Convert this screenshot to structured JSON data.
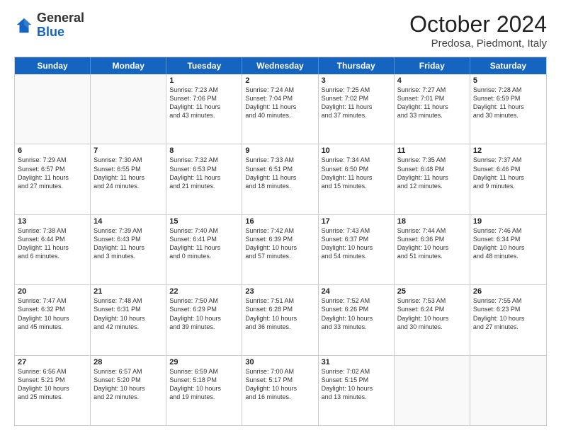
{
  "header": {
    "logo_general": "General",
    "logo_blue": "Blue",
    "month_year": "October 2024",
    "location": "Predosa, Piedmont, Italy"
  },
  "days_of_week": [
    "Sunday",
    "Monday",
    "Tuesday",
    "Wednesday",
    "Thursday",
    "Friday",
    "Saturday"
  ],
  "rows": [
    [
      {
        "day": "",
        "info": "",
        "empty": true
      },
      {
        "day": "",
        "info": "",
        "empty": true
      },
      {
        "day": "1",
        "info": "Sunrise: 7:23 AM\nSunset: 7:06 PM\nDaylight: 11 hours\nand 43 minutes."
      },
      {
        "day": "2",
        "info": "Sunrise: 7:24 AM\nSunset: 7:04 PM\nDaylight: 11 hours\nand 40 minutes."
      },
      {
        "day": "3",
        "info": "Sunrise: 7:25 AM\nSunset: 7:02 PM\nDaylight: 11 hours\nand 37 minutes."
      },
      {
        "day": "4",
        "info": "Sunrise: 7:27 AM\nSunset: 7:01 PM\nDaylight: 11 hours\nand 33 minutes."
      },
      {
        "day": "5",
        "info": "Sunrise: 7:28 AM\nSunset: 6:59 PM\nDaylight: 11 hours\nand 30 minutes."
      }
    ],
    [
      {
        "day": "6",
        "info": "Sunrise: 7:29 AM\nSunset: 6:57 PM\nDaylight: 11 hours\nand 27 minutes."
      },
      {
        "day": "7",
        "info": "Sunrise: 7:30 AM\nSunset: 6:55 PM\nDaylight: 11 hours\nand 24 minutes."
      },
      {
        "day": "8",
        "info": "Sunrise: 7:32 AM\nSunset: 6:53 PM\nDaylight: 11 hours\nand 21 minutes."
      },
      {
        "day": "9",
        "info": "Sunrise: 7:33 AM\nSunset: 6:51 PM\nDaylight: 11 hours\nand 18 minutes."
      },
      {
        "day": "10",
        "info": "Sunrise: 7:34 AM\nSunset: 6:50 PM\nDaylight: 11 hours\nand 15 minutes."
      },
      {
        "day": "11",
        "info": "Sunrise: 7:35 AM\nSunset: 6:48 PM\nDaylight: 11 hours\nand 12 minutes."
      },
      {
        "day": "12",
        "info": "Sunrise: 7:37 AM\nSunset: 6:46 PM\nDaylight: 11 hours\nand 9 minutes."
      }
    ],
    [
      {
        "day": "13",
        "info": "Sunrise: 7:38 AM\nSunset: 6:44 PM\nDaylight: 11 hours\nand 6 minutes."
      },
      {
        "day": "14",
        "info": "Sunrise: 7:39 AM\nSunset: 6:43 PM\nDaylight: 11 hours\nand 3 minutes."
      },
      {
        "day": "15",
        "info": "Sunrise: 7:40 AM\nSunset: 6:41 PM\nDaylight: 11 hours\nand 0 minutes."
      },
      {
        "day": "16",
        "info": "Sunrise: 7:42 AM\nSunset: 6:39 PM\nDaylight: 10 hours\nand 57 minutes."
      },
      {
        "day": "17",
        "info": "Sunrise: 7:43 AM\nSunset: 6:37 PM\nDaylight: 10 hours\nand 54 minutes."
      },
      {
        "day": "18",
        "info": "Sunrise: 7:44 AM\nSunset: 6:36 PM\nDaylight: 10 hours\nand 51 minutes."
      },
      {
        "day": "19",
        "info": "Sunrise: 7:46 AM\nSunset: 6:34 PM\nDaylight: 10 hours\nand 48 minutes."
      }
    ],
    [
      {
        "day": "20",
        "info": "Sunrise: 7:47 AM\nSunset: 6:32 PM\nDaylight: 10 hours\nand 45 minutes."
      },
      {
        "day": "21",
        "info": "Sunrise: 7:48 AM\nSunset: 6:31 PM\nDaylight: 10 hours\nand 42 minutes."
      },
      {
        "day": "22",
        "info": "Sunrise: 7:50 AM\nSunset: 6:29 PM\nDaylight: 10 hours\nand 39 minutes."
      },
      {
        "day": "23",
        "info": "Sunrise: 7:51 AM\nSunset: 6:28 PM\nDaylight: 10 hours\nand 36 minutes."
      },
      {
        "day": "24",
        "info": "Sunrise: 7:52 AM\nSunset: 6:26 PM\nDaylight: 10 hours\nand 33 minutes."
      },
      {
        "day": "25",
        "info": "Sunrise: 7:53 AM\nSunset: 6:24 PM\nDaylight: 10 hours\nand 30 minutes."
      },
      {
        "day": "26",
        "info": "Sunrise: 7:55 AM\nSunset: 6:23 PM\nDaylight: 10 hours\nand 27 minutes."
      }
    ],
    [
      {
        "day": "27",
        "info": "Sunrise: 6:56 AM\nSunset: 5:21 PM\nDaylight: 10 hours\nand 25 minutes."
      },
      {
        "day": "28",
        "info": "Sunrise: 6:57 AM\nSunset: 5:20 PM\nDaylight: 10 hours\nand 22 minutes."
      },
      {
        "day": "29",
        "info": "Sunrise: 6:59 AM\nSunset: 5:18 PM\nDaylight: 10 hours\nand 19 minutes."
      },
      {
        "day": "30",
        "info": "Sunrise: 7:00 AM\nSunset: 5:17 PM\nDaylight: 10 hours\nand 16 minutes."
      },
      {
        "day": "31",
        "info": "Sunrise: 7:02 AM\nSunset: 5:15 PM\nDaylight: 10 hours\nand 13 minutes."
      },
      {
        "day": "",
        "info": "",
        "empty": true
      },
      {
        "day": "",
        "info": "",
        "empty": true
      }
    ]
  ]
}
